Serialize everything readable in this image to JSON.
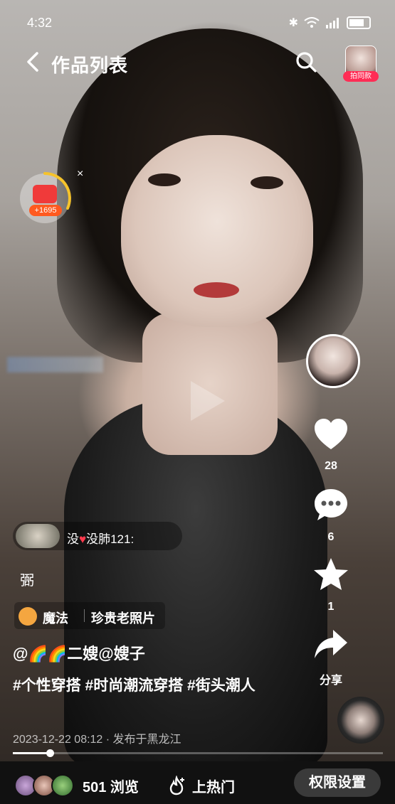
{
  "status_bar": {
    "time": "4:32",
    "icons": [
      "bluetooth-icon",
      "wifi-icon",
      "signal-icon",
      "battery-icon"
    ]
  },
  "header": {
    "back_icon": "chevron-left-icon",
    "title": "作品列表",
    "search_icon": "search-icon",
    "avatar_tag": "拍同款"
  },
  "red_packet": {
    "count": "+1695",
    "close": "×"
  },
  "right_rail": {
    "like_count": "28",
    "comment_count": "6",
    "favorite_count": "1",
    "share_label": "分享"
  },
  "comment_preview": {
    "heart": "♥",
    "text_pre": "没",
    "text_post": "没肺121:"
  },
  "glyph_line": "弻",
  "effect": {
    "label": "魔法",
    "name": "珍贵老照片"
  },
  "post": {
    "author": "@🌈🌈二嫂@嫂子",
    "hashtags": "#个性穿搭 #时尚潮流穿搭 #街头潮人",
    "date": "2023-12-22 08:12 · 发布于黑龙江"
  },
  "playback": {
    "progress": 0.1
  },
  "bottom_bar": {
    "views": "501 浏览",
    "hot_label": "上热门",
    "permission_button": "权限设置"
  },
  "colors": {
    "accent_red": "#ff2d55",
    "packet_orange": "#ff5a1f",
    "ring_yellow": "#f6c32b"
  }
}
